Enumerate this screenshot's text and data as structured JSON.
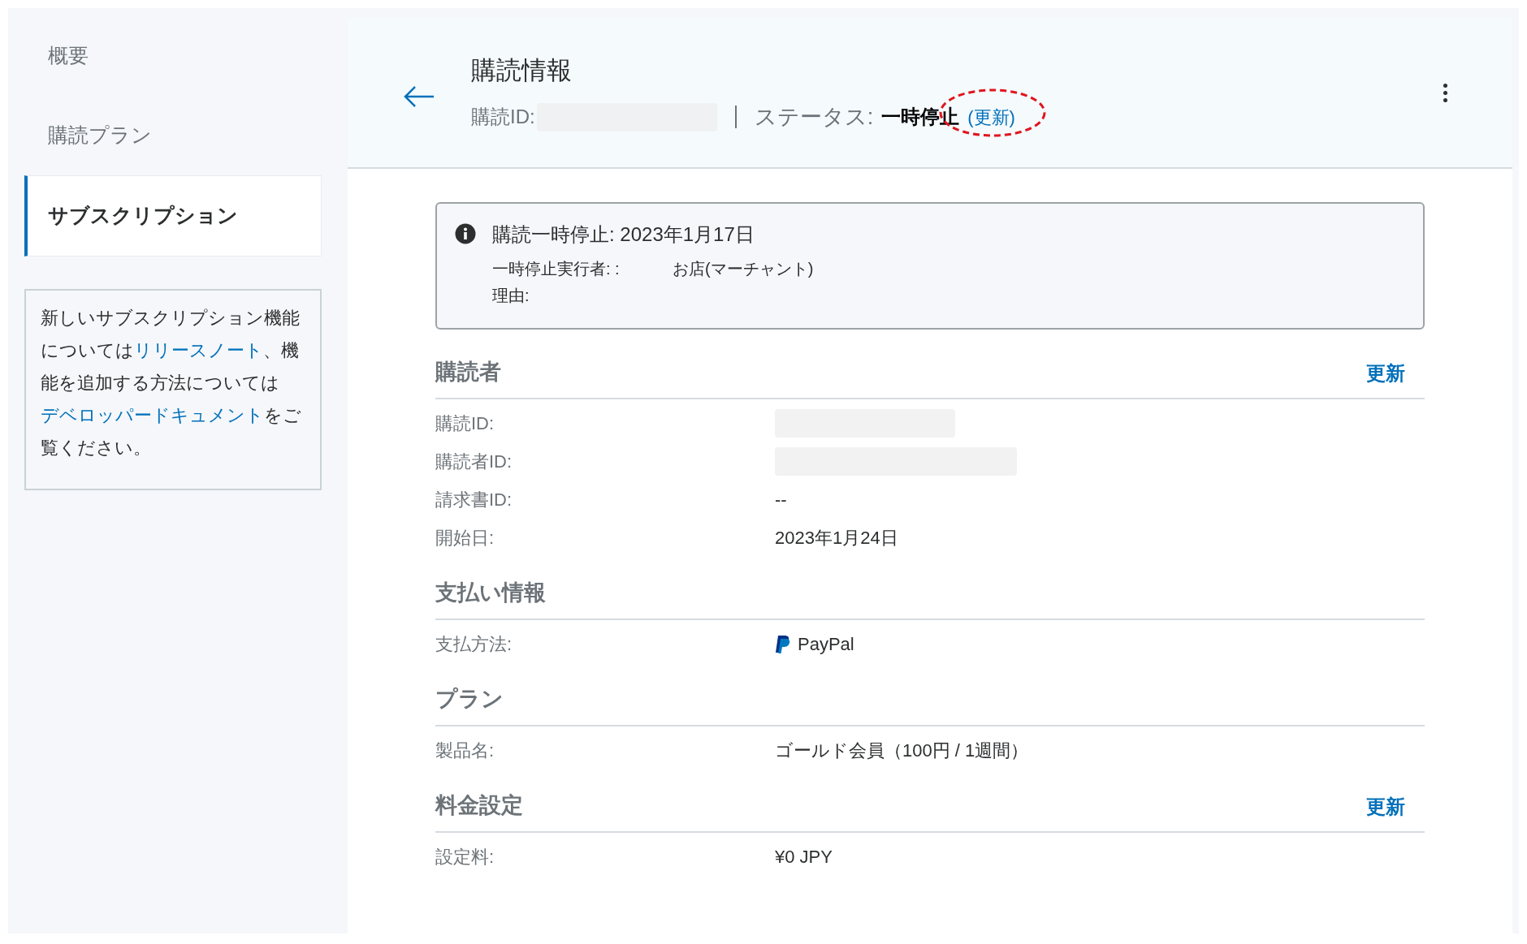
{
  "sidebar": {
    "items": [
      {
        "label": "概要",
        "selected": false
      },
      {
        "label": "購読プラン",
        "selected": false
      },
      {
        "label": "サブスクリプション",
        "selected": true
      }
    ],
    "note": [
      {
        "text": "新しいサブスクリプション機能については",
        "kind": "text"
      },
      {
        "text": "リリースノート",
        "kind": "link"
      },
      {
        "text": "、機能を追加する方法については",
        "kind": "text"
      },
      {
        "text": "デベロッパードキュメント",
        "kind": "link"
      },
      {
        "text": "をご覧ください。",
        "kind": "text"
      }
    ]
  },
  "header": {
    "title": "購読情報",
    "id_label": "購読ID:",
    "status_label": "ステータス:",
    "status_value": "一時停止",
    "update_link": "(更新)"
  },
  "notice": {
    "title": "購読一時停止: 2023年1月17日",
    "rows": [
      {
        "label": "一時停止実行者: :",
        "value": "お店(マーチャント)"
      },
      {
        "label": "理由:"
      }
    ]
  },
  "sections": [
    {
      "title": "購読者",
      "action": "更新",
      "rows": [
        {
          "label": "購読ID:",
          "kind": "redacted",
          "value": ""
        },
        {
          "label": "購読者ID:",
          "kind": "redacted_wide",
          "value": ""
        },
        {
          "label": "請求書ID:",
          "kind": "text",
          "value": "--"
        },
        {
          "label": "開始日:",
          "kind": "text",
          "value": "2023年1月24日"
        }
      ]
    },
    {
      "title": "支払い情報",
      "rows": [
        {
          "label": "支払方法:",
          "kind": "paypal",
          "value": "PayPal"
        }
      ]
    },
    {
      "title": "プラン",
      "rows": [
        {
          "label": "製品名:",
          "kind": "text",
          "value": "ゴールド会員（100円 / 1週間）"
        }
      ]
    },
    {
      "title": "料金設定",
      "action": "更新",
      "rows": [
        {
          "label": "設定料:",
          "kind": "text",
          "value": "¥0 JPY"
        }
      ]
    }
  ]
}
